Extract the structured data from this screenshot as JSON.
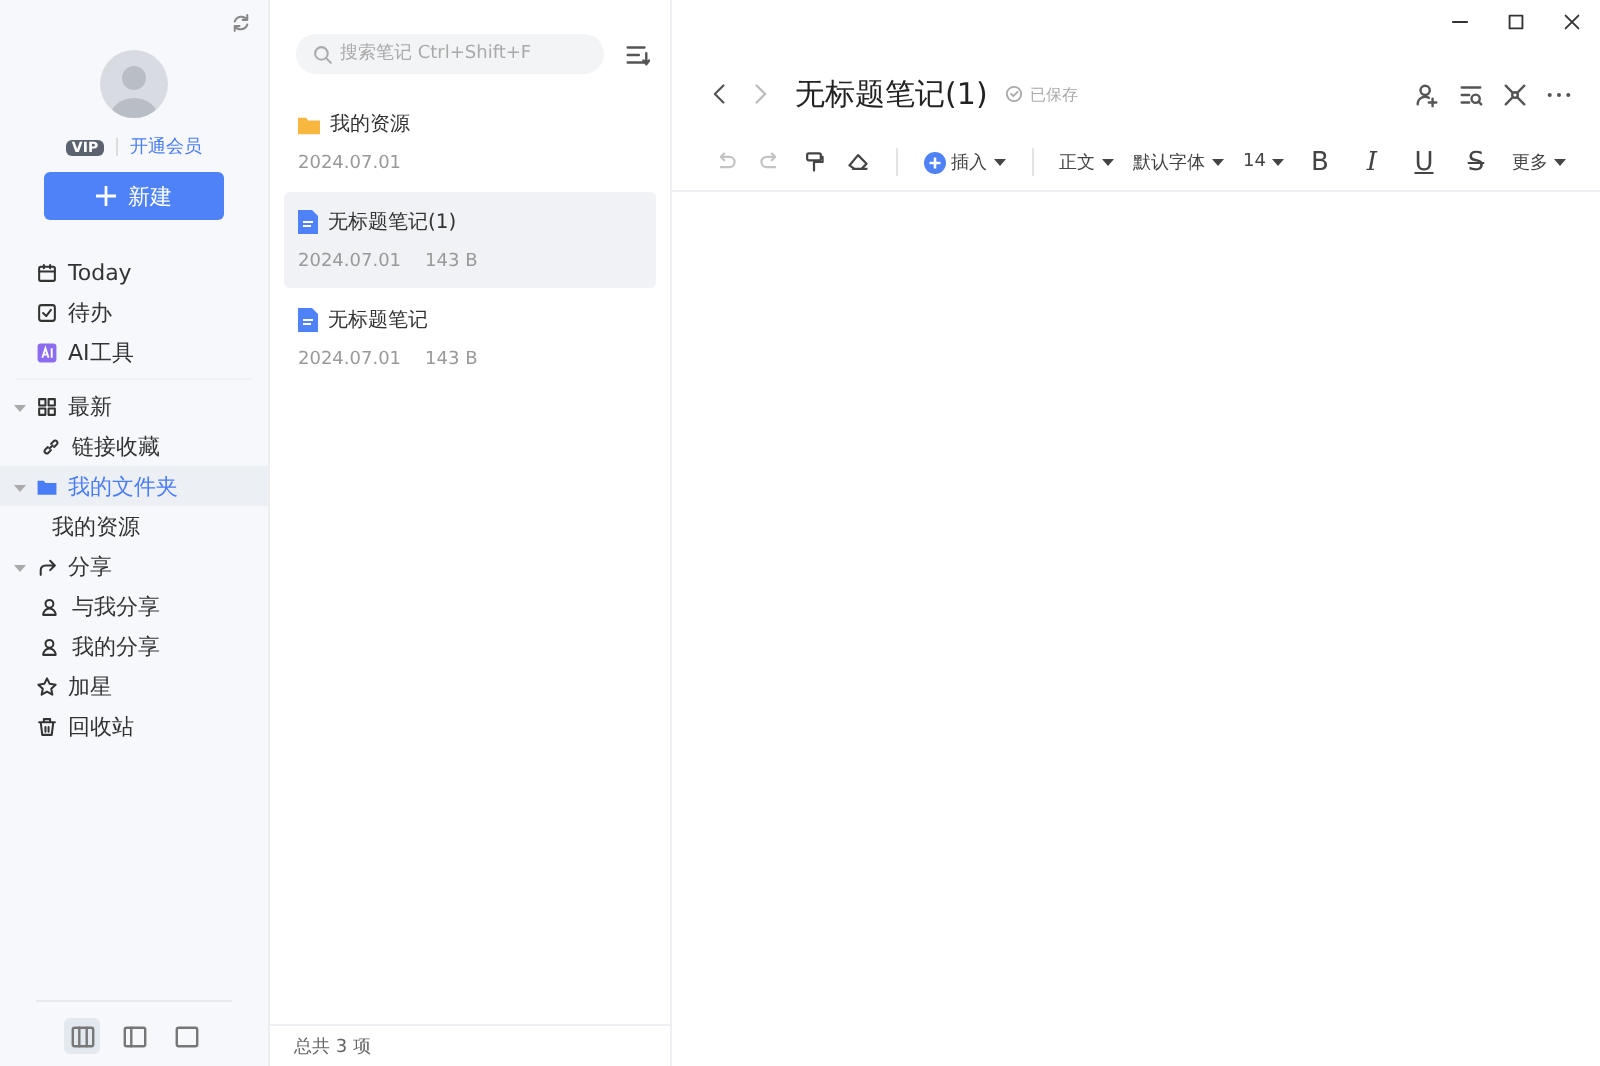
{
  "sidebar": {
    "vip_badge": "VIP",
    "vip_link": "开通会员",
    "new_button": "新建",
    "nav": [
      {
        "kind": "calendar",
        "label": "Today",
        "selected": false
      },
      {
        "kind": "todo",
        "label": "待办",
        "selected": false
      },
      {
        "kind": "ai",
        "label": "AI工具",
        "selected": false
      },
      {
        "kind": "grid",
        "label": "最新",
        "selected": false,
        "expanded": true,
        "children": [
          {
            "kind": "link",
            "label": "链接收藏",
            "selected": false
          }
        ]
      },
      {
        "kind": "folder",
        "label": "我的文件夹",
        "selected": true,
        "expanded": true,
        "children": [
          {
            "kind": "plain",
            "label": "我的资源",
            "selected": false
          }
        ]
      },
      {
        "kind": "share",
        "label": "分享",
        "selected": false,
        "expanded": true,
        "children": [
          {
            "kind": "user",
            "label": "与我分享",
            "selected": false
          },
          {
            "kind": "user",
            "label": "我的分享",
            "selected": false
          }
        ]
      },
      {
        "kind": "star",
        "label": "加星",
        "selected": false
      },
      {
        "kind": "trash",
        "label": "回收站",
        "selected": false
      }
    ],
    "layouts": [
      {
        "kind": "three",
        "selected": true
      },
      {
        "kind": "two",
        "selected": false
      },
      {
        "kind": "one",
        "selected": false
      }
    ]
  },
  "note_list": {
    "search": {
      "placeholder": "搜索笔记 Ctrl+Shift+F"
    },
    "items": [
      {
        "kind": "folder",
        "title": "我的资源",
        "date": "2024.07.01",
        "selected": false
      },
      {
        "kind": "note",
        "title": "无标题笔记(1)",
        "date": "2024.07.01",
        "size": "143 B",
        "selected": true
      },
      {
        "kind": "note",
        "title": "无标题笔记",
        "date": "2024.07.01",
        "size": "143 B",
        "selected": false
      }
    ],
    "footer": "总共 3 项"
  },
  "editor": {
    "title": "无标题笔记(1)",
    "status": "已保存",
    "toolbar": [
      {
        "kind": "undo",
        "disabled": true
      },
      {
        "kind": "redo",
        "disabled": true
      },
      {
        "kind": "painter",
        "disabled": false
      },
      {
        "kind": "eraser",
        "disabled": false
      },
      {
        "kind": "sep"
      },
      {
        "kind": "insert",
        "label": "插入"
      },
      {
        "kind": "sep"
      },
      {
        "kind": "dropdown",
        "label": "正文"
      },
      {
        "kind": "dropdown",
        "label": "默认字体"
      },
      {
        "kind": "dropdown",
        "label": "14"
      },
      {
        "kind": "bold",
        "label": "B"
      },
      {
        "kind": "italic",
        "label": "I"
      },
      {
        "kind": "underline",
        "label": "U"
      },
      {
        "kind": "strike",
        "label": "S"
      },
      {
        "kind": "dropdown",
        "label": "更多"
      }
    ]
  }
}
